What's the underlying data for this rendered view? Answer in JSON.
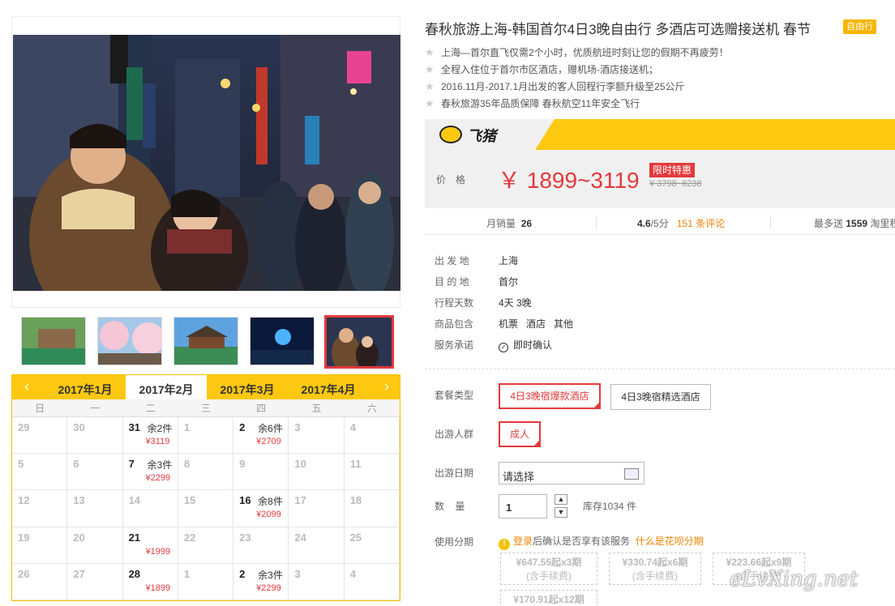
{
  "product": {
    "title": "春秋旅游上海-韩国首尔4日3晚自由行 多酒店可选赠接送机 春节",
    "tag": "自由行",
    "features": [
      "上海—首尔直飞仅需2个小时，优质航班时刻让您的假期不再疲劳！",
      "全程入住位于首尔市区酒店，赠机场-酒店接送机；",
      "2016.11月-2017.1月出发的客人回程行李额升级至25公斤",
      "春秋旅游35年品质保障 春秋航空11年安全飞行"
    ]
  },
  "gallery": {
    "thumbnails": [
      "thumb-1",
      "thumb-2",
      "thumb-3",
      "thumb-4",
      "thumb-5"
    ],
    "active_index": 4
  },
  "calendar": {
    "prev_icon": "‹",
    "next_icon": "›",
    "months": [
      "2017年1月",
      "2017年2月",
      "2017年3月",
      "2017年4月"
    ],
    "active_month": "2017年2月",
    "weekdays": [
      "日",
      "一",
      "二",
      "三",
      "四",
      "五",
      "六"
    ],
    "weeks": [
      [
        {
          "d": "29"
        },
        {
          "d": "30"
        },
        {
          "d": "31",
          "rem": "余2件",
          "price": "¥3119"
        },
        {
          "d": "1"
        },
        {
          "d": "2",
          "rem": "余6件",
          "price": "¥2709"
        },
        {
          "d": "3"
        },
        {
          "d": "4"
        }
      ],
      [
        {
          "d": "5"
        },
        {
          "d": "6"
        },
        {
          "d": "7",
          "rem": "余3件",
          "price": "¥2299"
        },
        {
          "d": "8"
        },
        {
          "d": "9"
        },
        {
          "d": "10"
        },
        {
          "d": "11"
        }
      ],
      [
        {
          "d": "12"
        },
        {
          "d": "13"
        },
        {
          "d": "14"
        },
        {
          "d": "15"
        },
        {
          "d": "16",
          "rem": "余8件",
          "price": "¥2099"
        },
        {
          "d": "17"
        },
        {
          "d": "18"
        }
      ],
      [
        {
          "d": "19"
        },
        {
          "d": "20"
        },
        {
          "d": "21",
          "price": "¥1999"
        },
        {
          "d": "22"
        },
        {
          "d": "23"
        },
        {
          "d": "24"
        },
        {
          "d": "25"
        }
      ],
      [
        {
          "d": "26"
        },
        {
          "d": "27"
        },
        {
          "d": "28",
          "price": "¥1899"
        },
        {
          "d": "1"
        },
        {
          "d": "2",
          "rem": "余3件",
          "price": "¥2299"
        },
        {
          "d": "3"
        },
        {
          "d": "4"
        }
      ]
    ]
  },
  "price": {
    "brand": "飞猪",
    "label": "价格",
    "value": "￥ 1899~3119",
    "promo_tag": "限时特惠",
    "original": "¥ 3798~6238"
  },
  "stats": {
    "monthly_sales_label": "月销量",
    "monthly_sales": "26",
    "rating": "4.6",
    "rating_suffix": "/5分",
    "reviews": "151 条评论",
    "points_label": "最多送",
    "points": "1559",
    "points_suffix": "淘里程"
  },
  "details": [
    {
      "label": "出 发 地",
      "value": "上海"
    },
    {
      "label": "目 的 地",
      "value": "首尔"
    },
    {
      "label": "行程天数",
      "value": "4天 3晚"
    },
    {
      "label": "商品包含",
      "value": "机票   酒店   其他"
    },
    {
      "label": "服务承诺",
      "value": "即时确认"
    }
  ],
  "options": {
    "package_label": "套餐类型",
    "packages": [
      "4日3晚宿爆款酒店",
      "4日3晚宿精选酒店"
    ],
    "crowd_label": "出游人群",
    "crowd": "成人",
    "date_label": "出游日期",
    "date_placeholder": "请选择",
    "qty_label": "数    量",
    "qty_value": "1",
    "stock": "库存1034 件",
    "installment_label": "使用分期",
    "installment_login": "登录",
    "installment_text": "后确认是否享有该服务",
    "installment_link": "什么是花呗分期",
    "installments": [
      {
        "amount": "¥647.55起x3期",
        "fee": "(含手续费)"
      },
      {
        "amount": "¥330.74起x6期",
        "fee": "(含手续费)"
      },
      {
        "amount": "¥223.66起x9期",
        "fee": "(含手续费)"
      },
      {
        "amount": "¥170.91起x12期",
        "fee": ""
      }
    ]
  },
  "watermark": "eLvXing.net"
}
